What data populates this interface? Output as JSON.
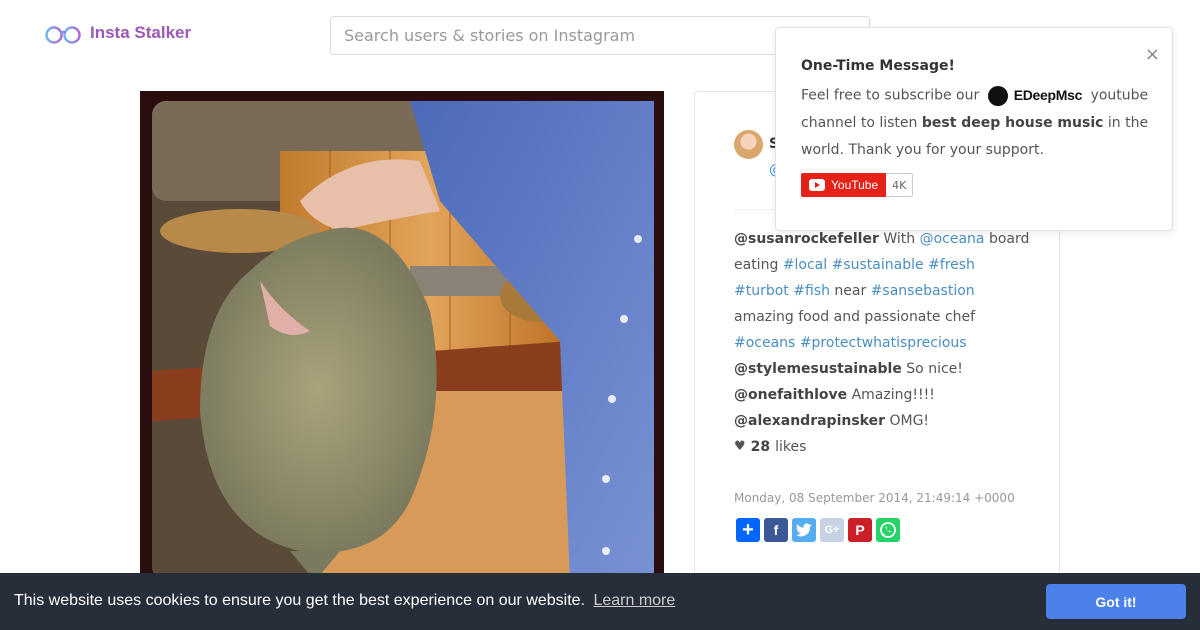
{
  "header": {
    "logo_text": "Insta Stalker",
    "search_placeholder": "Search users & stories on Instagram"
  },
  "post": {
    "username_initial": "S",
    "handle_initial": "@",
    "caption": {
      "author": "@susanrockefeller",
      "segments": [
        {
          "text": "With ",
          "tag": false
        },
        {
          "text": "@oceana",
          "tag": true
        },
        {
          "text": " board eating ",
          "tag": false
        },
        {
          "text": "#local",
          "tag": true
        },
        {
          "text": " ",
          "tag": false
        },
        {
          "text": "#sustainable",
          "tag": true
        },
        {
          "text": " ",
          "tag": false
        },
        {
          "text": "#fresh",
          "tag": true
        },
        {
          "text": " ",
          "tag": false
        },
        {
          "text": "#turbot",
          "tag": true
        },
        {
          "text": " ",
          "tag": false
        },
        {
          "text": "#fish",
          "tag": true
        },
        {
          "text": " near ",
          "tag": false
        },
        {
          "text": "#sansebastion",
          "tag": true
        },
        {
          "text": " amazing food and passionate chef ",
          "tag": false
        },
        {
          "text": "#oceans",
          "tag": true
        },
        {
          "text": " ",
          "tag": false
        },
        {
          "text": "#protectwhatisprecious",
          "tag": true
        }
      ]
    },
    "comments": [
      {
        "user": "@stylemesustainable",
        "text": "So nice!"
      },
      {
        "user": "@onefaithlove",
        "text": "Amazing!!!!"
      },
      {
        "user": "@alexandrapinsker",
        "text": "OMG!"
      }
    ],
    "likes_count": "28",
    "likes_label": "likes",
    "timestamp": "Monday, 08 September 2014, 21:49:14 +0000",
    "share_buttons": [
      "add",
      "facebook",
      "twitter",
      "google-plus",
      "pinterest",
      "whatsapp"
    ]
  },
  "popup": {
    "title": "One-Time Message!",
    "text_before": "Feel free to subscribe our",
    "brand": "EDeepMsc",
    "text_after_brand": "youtube channel to listen",
    "bold_text": "best deep house music",
    "text_end": "in the world. Thank you for your support.",
    "close_glyph": "×",
    "yt_label": "YouTube",
    "yt_count": "4K"
  },
  "cookie": {
    "text": "This website uses cookies to ensure you get the best experience on our website.",
    "link": "Learn more",
    "button": "Got it!"
  },
  "colors": {
    "brand_purple": "#9b59b6",
    "link_blue": "#4a8ec2",
    "cookie_bg": "#252e39",
    "cookie_button": "#4b81e8",
    "youtube_red": "#e62117"
  }
}
